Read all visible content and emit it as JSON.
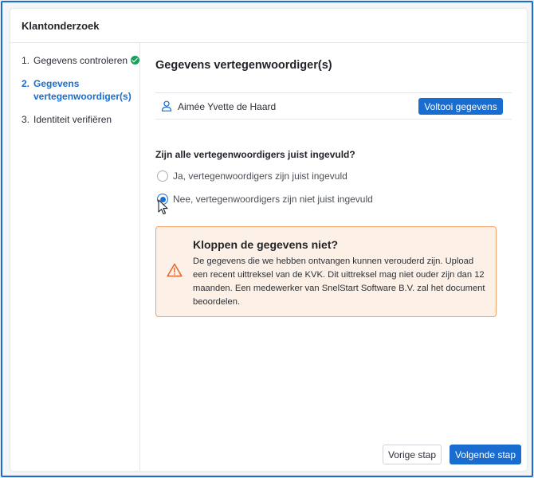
{
  "app": {
    "title": "Klantonderzoek"
  },
  "steps": [
    {
      "number": "1.",
      "label": "Gegevens controleren",
      "state": "completed"
    },
    {
      "number": "2.",
      "label": "Gegevens vertegenwoordiger(s)",
      "state": "active"
    },
    {
      "number": "3.",
      "label": "Identiteit verifiëren",
      "state": "pending"
    }
  ],
  "section": {
    "title": "Gegevens vertegenwoordiger(s)"
  },
  "representative": {
    "name": "Aimée Yvette de Haard",
    "icon": "user-icon",
    "button_label": "Voltooi gegevens"
  },
  "question": {
    "text": "Zijn alle vertegenwoordigers juist ingevuld?",
    "options": [
      {
        "label": "Ja, vertegenwoordigers zijn juist ingevuld",
        "selected": false
      },
      {
        "label": "Nee, vertegenwoordigers zijn niet juist ingevuld",
        "selected": true
      }
    ]
  },
  "alert": {
    "icon": "warning-icon",
    "title": "Kloppen de gegevens niet?",
    "body": "De gegevens die we hebben ontvangen kunnen verouderd zijn. Upload een recent uittreksel van de KVK. Dit uittreksel mag niet ouder zijn dan 12 maanden. Een medewerker van SnelStart Software B.V. zal het document beoordelen."
  },
  "footer": {
    "previous_label": "Vorige stap",
    "next_label": "Volgende stap"
  },
  "colors": {
    "accent": "#1a6dd0",
    "success": "#1a9e5a",
    "warning_border": "#f0a26a",
    "warning_bg": "#fdf1e7",
    "warning_icon": "#e8622a"
  }
}
